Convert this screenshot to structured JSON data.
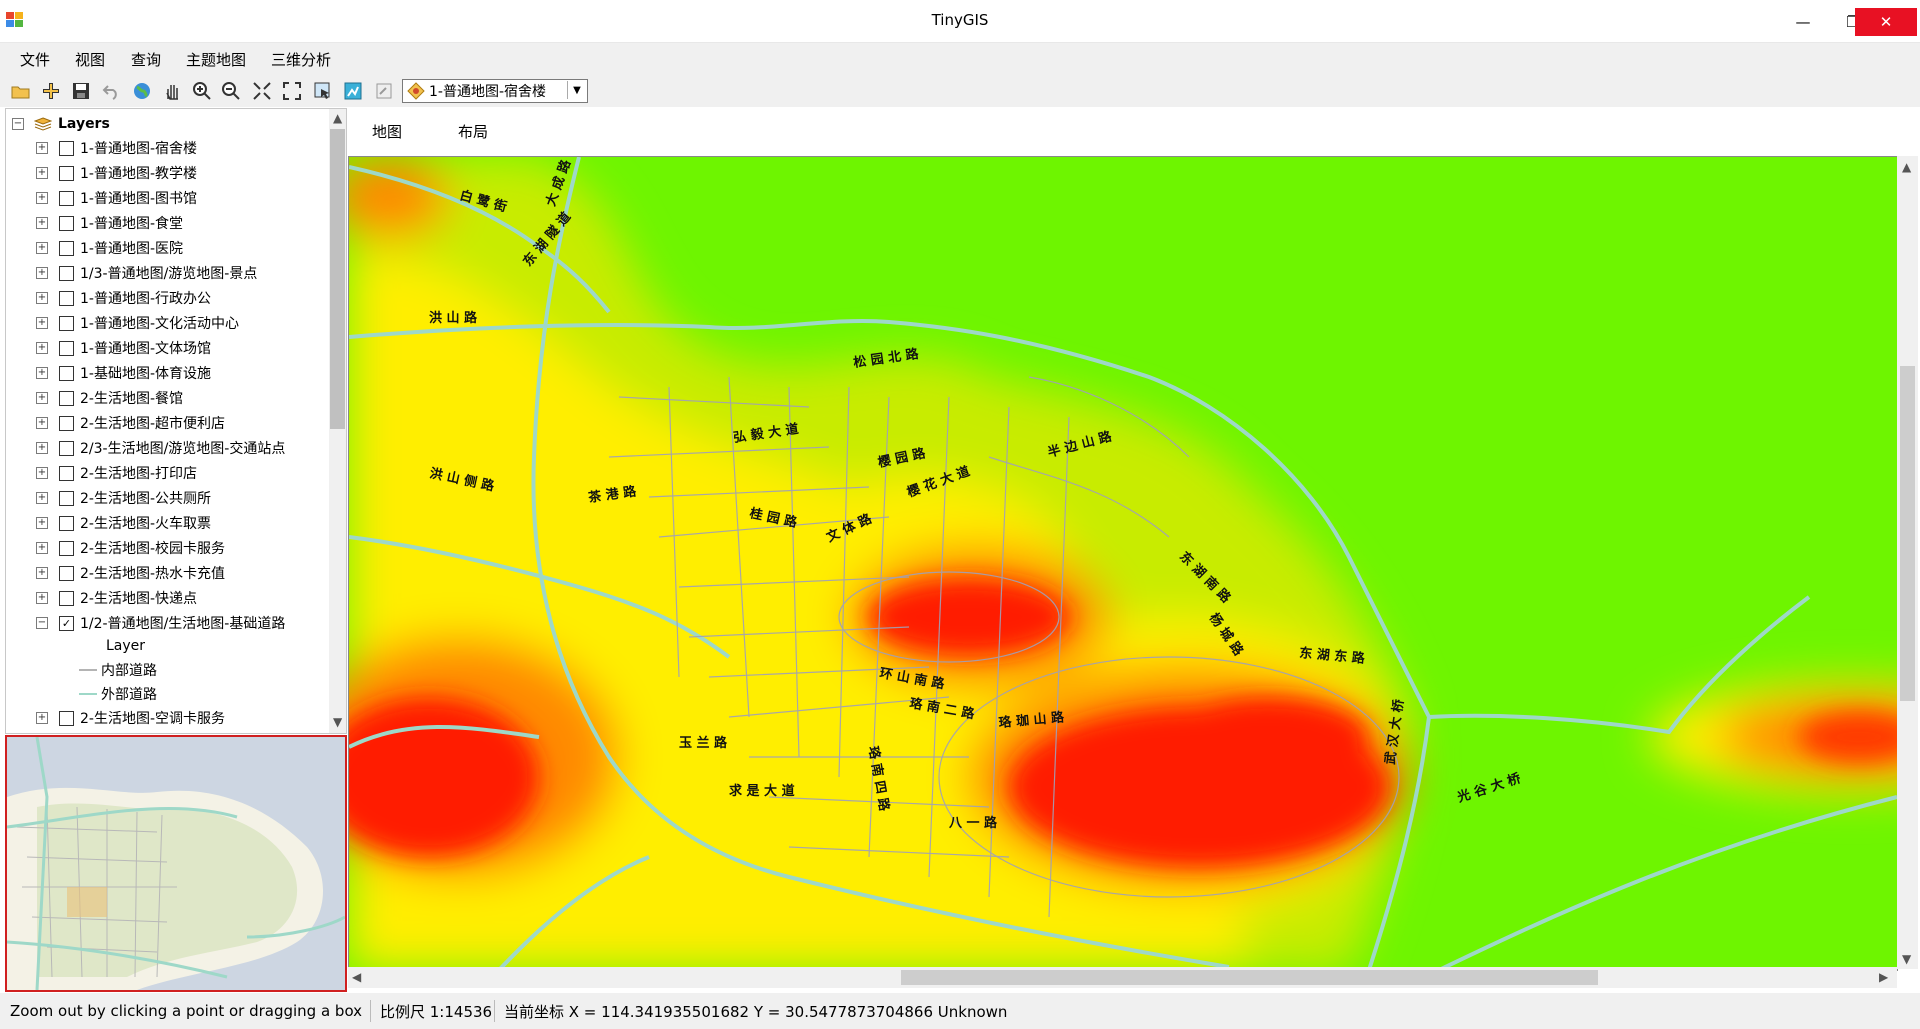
{
  "window": {
    "title": "TinyGIS",
    "minimize_glyph": "—",
    "maximize_glyph": "❐",
    "close_glyph": "✕"
  },
  "menu": [
    "文件",
    "视图",
    "查询",
    "主题地图",
    "三维分析"
  ],
  "toolbar": {
    "icons": [
      "open-folder-icon",
      "add-data-icon",
      "save-icon",
      "undo-icon",
      "globe-icon",
      "pan-hand-icon",
      "zoom-in-icon",
      "zoom-out-icon",
      "full-extent-icon",
      "fixed-zoom-icon",
      "select-features-icon",
      "identify-icon",
      "edit-icon"
    ],
    "layer_select_value": "1-普通地图-宿舍楼"
  },
  "layers": {
    "root_label": "Layers",
    "items": [
      {
        "label": "1-普通地图-宿舍楼",
        "checked": false
      },
      {
        "label": "1-普通地图-教学楼",
        "checked": false
      },
      {
        "label": "1-普通地图-图书馆",
        "checked": false
      },
      {
        "label": "1-普通地图-食堂",
        "checked": false
      },
      {
        "label": "1-普通地图-医院",
        "checked": false
      },
      {
        "label": "1/3-普通地图/游览地图-景点",
        "checked": false
      },
      {
        "label": "1-普通地图-行政办公",
        "checked": false
      },
      {
        "label": "1-普通地图-文化活动中心",
        "checked": false
      },
      {
        "label": "1-普通地图-文体场馆",
        "checked": false
      },
      {
        "label": "1-基础地图-体育设施",
        "checked": false
      },
      {
        "label": "2-生活地图-餐馆",
        "checked": false
      },
      {
        "label": "2-生活地图-超市便利店",
        "checked": false
      },
      {
        "label": "2/3-生活地图/游览地图-交通站点",
        "checked": false
      },
      {
        "label": "2-生活地图-打印店",
        "checked": false
      },
      {
        "label": "2-生活地图-公共厕所",
        "checked": false
      },
      {
        "label": "2-生活地图-火车取票",
        "checked": false
      },
      {
        "label": "2-生活地图-校园卡服务",
        "checked": false
      },
      {
        "label": "2-生活地图-热水卡充值",
        "checked": false
      },
      {
        "label": "2-生活地图-快递点",
        "checked": false
      },
      {
        "label": "1/2-普通地图/生活地图-基础道路",
        "checked": true
      }
    ],
    "legend": {
      "field": "Layer",
      "entries": [
        {
          "label": "内部道路",
          "color": "#b4b4b4"
        },
        {
          "label": "外部道路",
          "color": "#9ed8c8"
        }
      ]
    },
    "last_item": {
      "label": "2-生活地图-空调卡服务",
      "checked": false
    }
  },
  "tabs": [
    "地图",
    "布局"
  ],
  "map": {
    "colors": {
      "base": "#6ef500",
      "low": "#c8ec00",
      "mid": "#ffee00",
      "high": "#ff8a00",
      "peak": "#ff1a00",
      "outer_road": "#9ed8c8",
      "inner_road": "#a0a0b8"
    },
    "road_labels": [
      "白 鹭 街",
      "大 成 路",
      "东 湖 隧 道",
      "洪 山 路",
      "洪 山 侧 路",
      "茶 港 路",
      "松 园 北 路",
      "桂 园 路",
      "樱 园 路",
      "弘 毅 大 道",
      "樱 花 大 道",
      "文 体 路",
      "半 边 山 路",
      "东 湖 南 路",
      "杨 城 路",
      "环 山 南 路",
      "东 湖 东 路",
      "珞 珈 山 路",
      "珞 南 四 路",
      "珞 南 二 路",
      "玉 兰 路",
      "求 是 大 道",
      "八 一 路",
      "武 汉 大 桥",
      "光 谷 大 桥"
    ]
  },
  "status": {
    "hint": "Zoom out by clicking a point or dragging a box",
    "scale": "比例尺 1:14536",
    "coords": "当前坐标 X = 114.341935501682 Y = 30.5477873704866 Unknown"
  }
}
